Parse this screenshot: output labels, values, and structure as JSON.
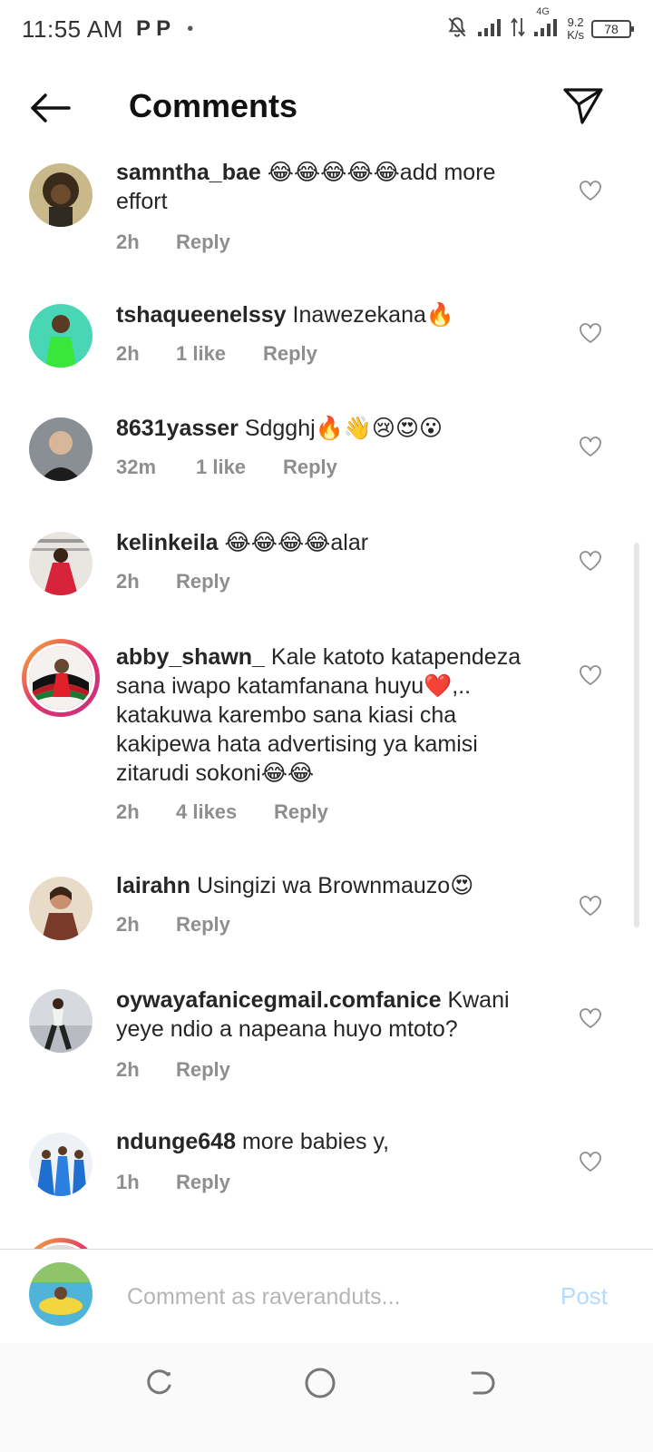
{
  "status_bar": {
    "time": "11:55 AM",
    "notif_icons": "P P",
    "dot": "•",
    "network": "4G",
    "speed_value": "9.2",
    "speed_unit": "K/s",
    "battery": "78"
  },
  "header": {
    "title": "Comments"
  },
  "comments": [
    {
      "username": "samntha_bae",
      "text": "😂😂😂😂😂add more effort",
      "time": "2h",
      "likes": "",
      "reply": "Reply"
    },
    {
      "username": "tshaqueenelssy",
      "text": "Inawezekana🔥",
      "time": "2h",
      "likes": "1 like",
      "reply": "Reply"
    },
    {
      "username": "8631yasser",
      "text": "Sdgghj🔥👋😢😍😮",
      "time": "32m",
      "likes": "1 like",
      "reply": "Reply"
    },
    {
      "username": "kelinkeila",
      "text": "😂😂😂😂alar",
      "time": "2h",
      "likes": "",
      "reply": "Reply"
    },
    {
      "username": "abby_shawn_",
      "text": "Kale katoto katapendeza sana iwapo katamfanana huyu❤️,.. katakuwa karembo sana kiasi cha kakipewa hata advertising ya kamisi zitarudi sokoni😂😂",
      "time": "2h",
      "likes": "4 likes",
      "reply": "Reply"
    },
    {
      "username": "lairahn",
      "text": "Usingizi wa Brownmauzo😍",
      "time": "2h",
      "likes": "",
      "reply": "Reply"
    },
    {
      "username": "oywayafanicegmail.comfanice",
      "text": "Kwani yeye ndio a napeana huyo mtoto?",
      "time": "2h",
      "likes": "",
      "reply": "Reply"
    },
    {
      "username": "ndunge648",
      "text": "more babies y,",
      "time": "1h",
      "likes": "",
      "reply": "Reply"
    }
  ],
  "composer": {
    "placeholder": "Comment as raveranduts...",
    "post_label": "Post"
  },
  "colors": {
    "text": "#262626",
    "meta": "#8e8e8e",
    "post_disabled": "#b3dbff",
    "story_ring": "#e1306c"
  }
}
